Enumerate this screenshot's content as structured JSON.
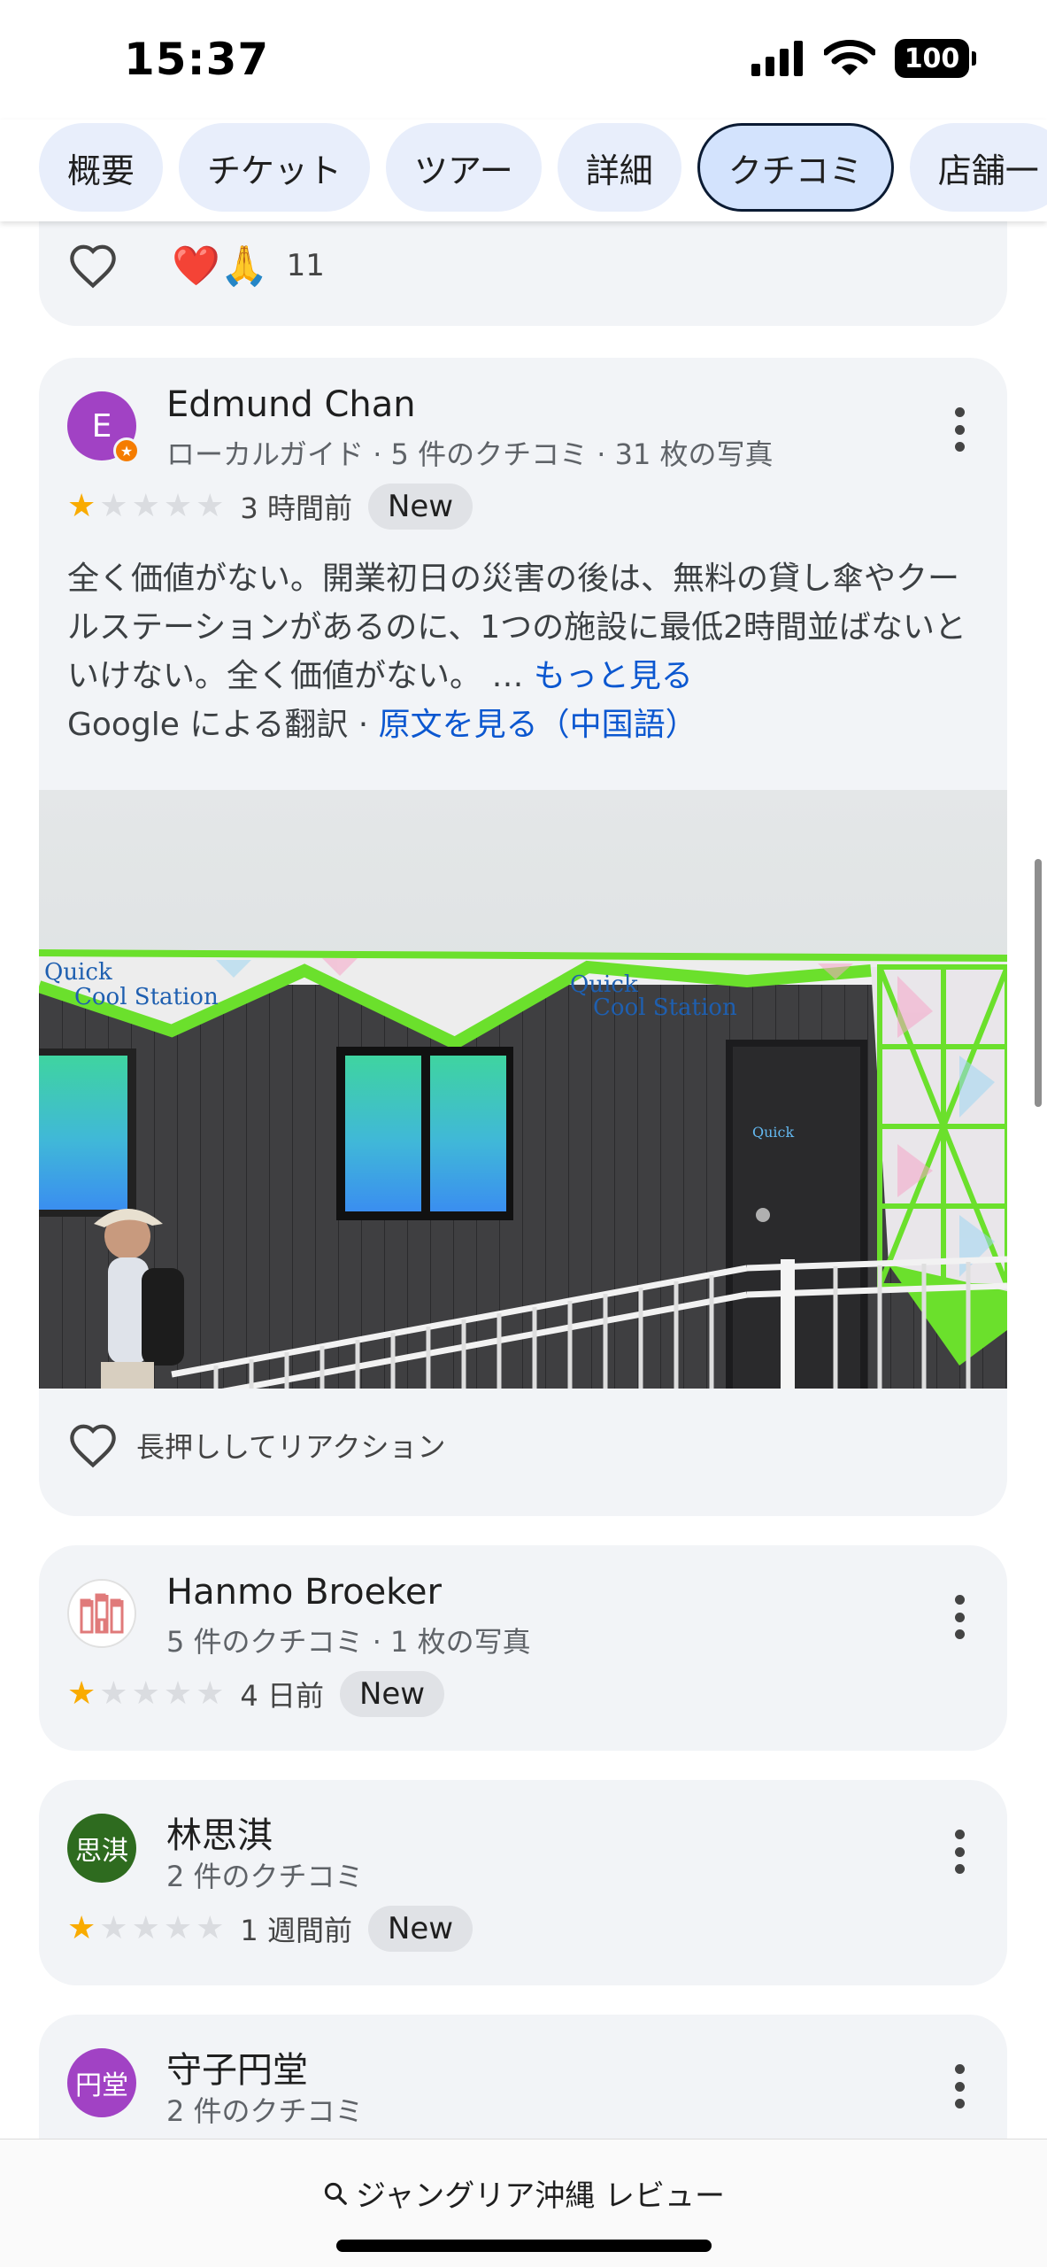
{
  "status_bar": {
    "time": "15:37",
    "battery": "100"
  },
  "tabs": [
    {
      "label": "概要"
    },
    {
      "label": "チケット"
    },
    {
      "label": "ツアー"
    },
    {
      "label": "詳細"
    },
    {
      "label": "クチコミ",
      "active": true
    },
    {
      "label": "店舗一"
    }
  ],
  "prev_card": {
    "emojis": "❤️🙏",
    "count": "11"
  },
  "reviews": [
    {
      "name": "Edmund Chan",
      "avatar_letter": "E",
      "avatar_color": "#a142c4",
      "meta": "ローカルガイド · 5 件のクチコミ · 31 枚の写真",
      "rating": 1,
      "time": "3 時間前",
      "badge": "New",
      "text": "全く価値がない。開業初日の災害の後は、無料の貸し傘やクールステーションがあるのに、1つの施設に最低2時間並ばないといけない。全く価値がない。 … ",
      "more_link": "もっと見る",
      "translation_prefix": "Google による翻訳 · ",
      "translation_link": "原文を見る（中国語）",
      "photo_signs": [
        "Quick",
        "Cool Station",
        "Quick",
        "Cool Station"
      ],
      "react_label": "長押ししてリアクション"
    },
    {
      "name": "Hanmo Broeker",
      "meta": "5 件のクチコミ · 1 枚の写真",
      "rating": 1,
      "time": "4 日前",
      "badge": "New"
    },
    {
      "name": "林思淇",
      "avatar_letter": "思淇",
      "avatar_color": "#2e6b1f",
      "meta": "2 件のクチコミ",
      "rating": 1,
      "time": "1 週間前",
      "badge": "New"
    },
    {
      "name": "守子円堂",
      "avatar_letter": "円堂",
      "avatar_color": "#a142c4",
      "meta": "2 件のクチコミ"
    }
  ],
  "search": {
    "query": "ジャングリア沖縄 レビュー"
  },
  "colors": {
    "accent": "#0b57d0",
    "star": "#f9ab00",
    "card_bg": "#f2f4f7"
  }
}
